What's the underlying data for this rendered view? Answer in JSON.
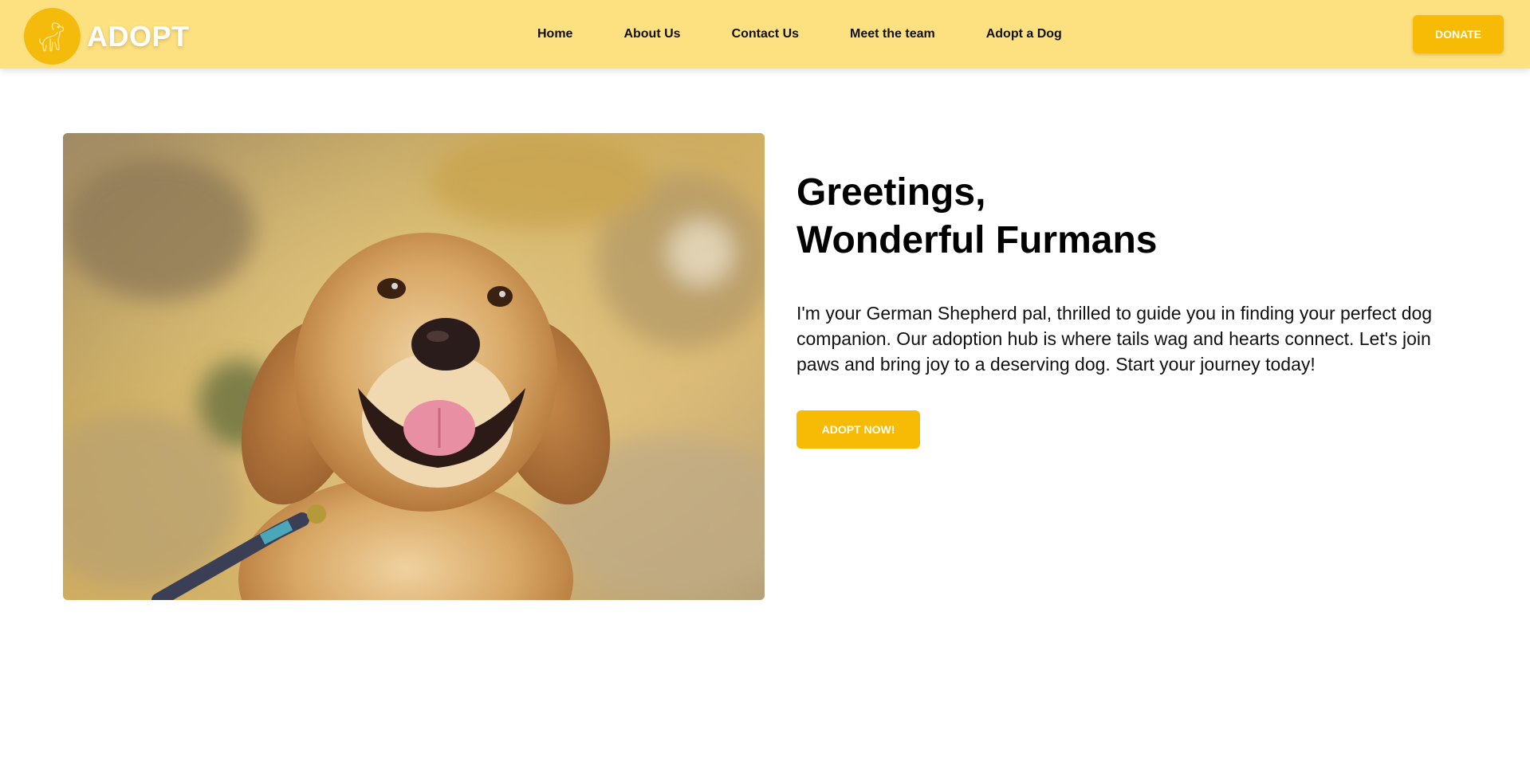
{
  "brand": {
    "logo_text": "ADOPT",
    "logo_icon": "dog-outline-icon",
    "colors": {
      "navbar_bg": "#fde080",
      "accent": "#f7bb05",
      "logo_badge": "#f5bb0c"
    }
  },
  "nav": {
    "items": [
      {
        "label": "Home"
      },
      {
        "label": "About Us"
      },
      {
        "label": "Contact Us"
      },
      {
        "label": "Meet the team"
      },
      {
        "label": "Adopt a Dog"
      }
    ],
    "donate_label": "DONATE"
  },
  "hero": {
    "image_subject": "golden retriever photo",
    "title_line1": "Greetings,",
    "title_line2": "Wonderful Furmans",
    "description": "I'm your German Shepherd pal, thrilled to guide you in finding your perfect dog companion. Our adoption hub is where tails wag and hearts connect. Let's join paws and bring joy to a deserving dog. Start your journey today!",
    "cta_label": "ADOPT NOW!"
  }
}
